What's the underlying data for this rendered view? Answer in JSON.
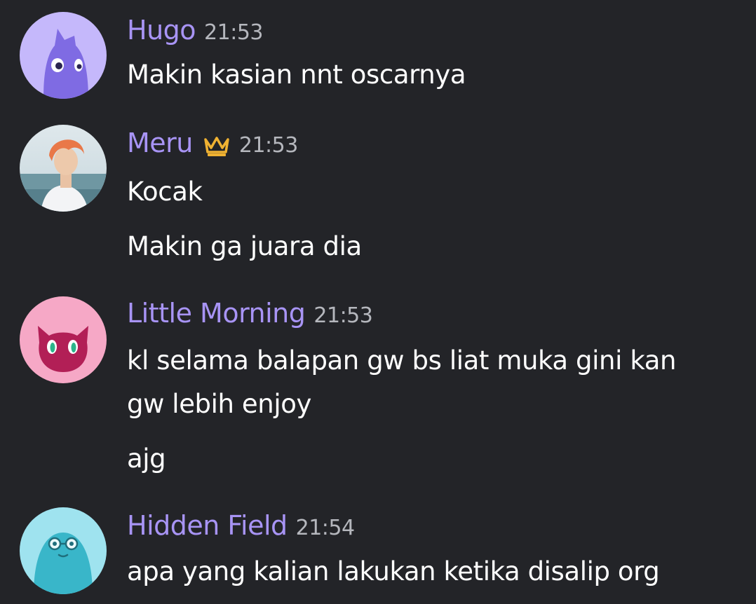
{
  "messages": [
    {
      "author": "Hugo",
      "time": "21:53",
      "avatar_icon": "purple-cat-avatar-icon",
      "lines": [
        "Makin kasian nnt oscarnya"
      ]
    },
    {
      "author": "Meru",
      "time": "21:53",
      "avatar_icon": "orange-hair-photo-avatar-icon",
      "badge_icon": "crown-icon",
      "lines": [
        "Kocak",
        "Makin ga juara dia"
      ]
    },
    {
      "author": "Little Morning",
      "time": "21:53",
      "avatar_icon": "pink-devil-avatar-icon",
      "lines": [
        "kl selama balapan gw bs liat muka gini kan",
        "gw lebih enjoy",
        "ajg"
      ]
    },
    {
      "author": "Hidden Field",
      "time": "21:54",
      "avatar_icon": "teal-blob-avatar-icon",
      "lines": [
        "apa yang kalian lakukan ketika disalip org"
      ]
    }
  ],
  "colors": {
    "background": "#232428",
    "username": "#a894f5",
    "timestamp": "#b5b7bd",
    "message_text": "#ffffff",
    "crown": "#f0b232"
  }
}
